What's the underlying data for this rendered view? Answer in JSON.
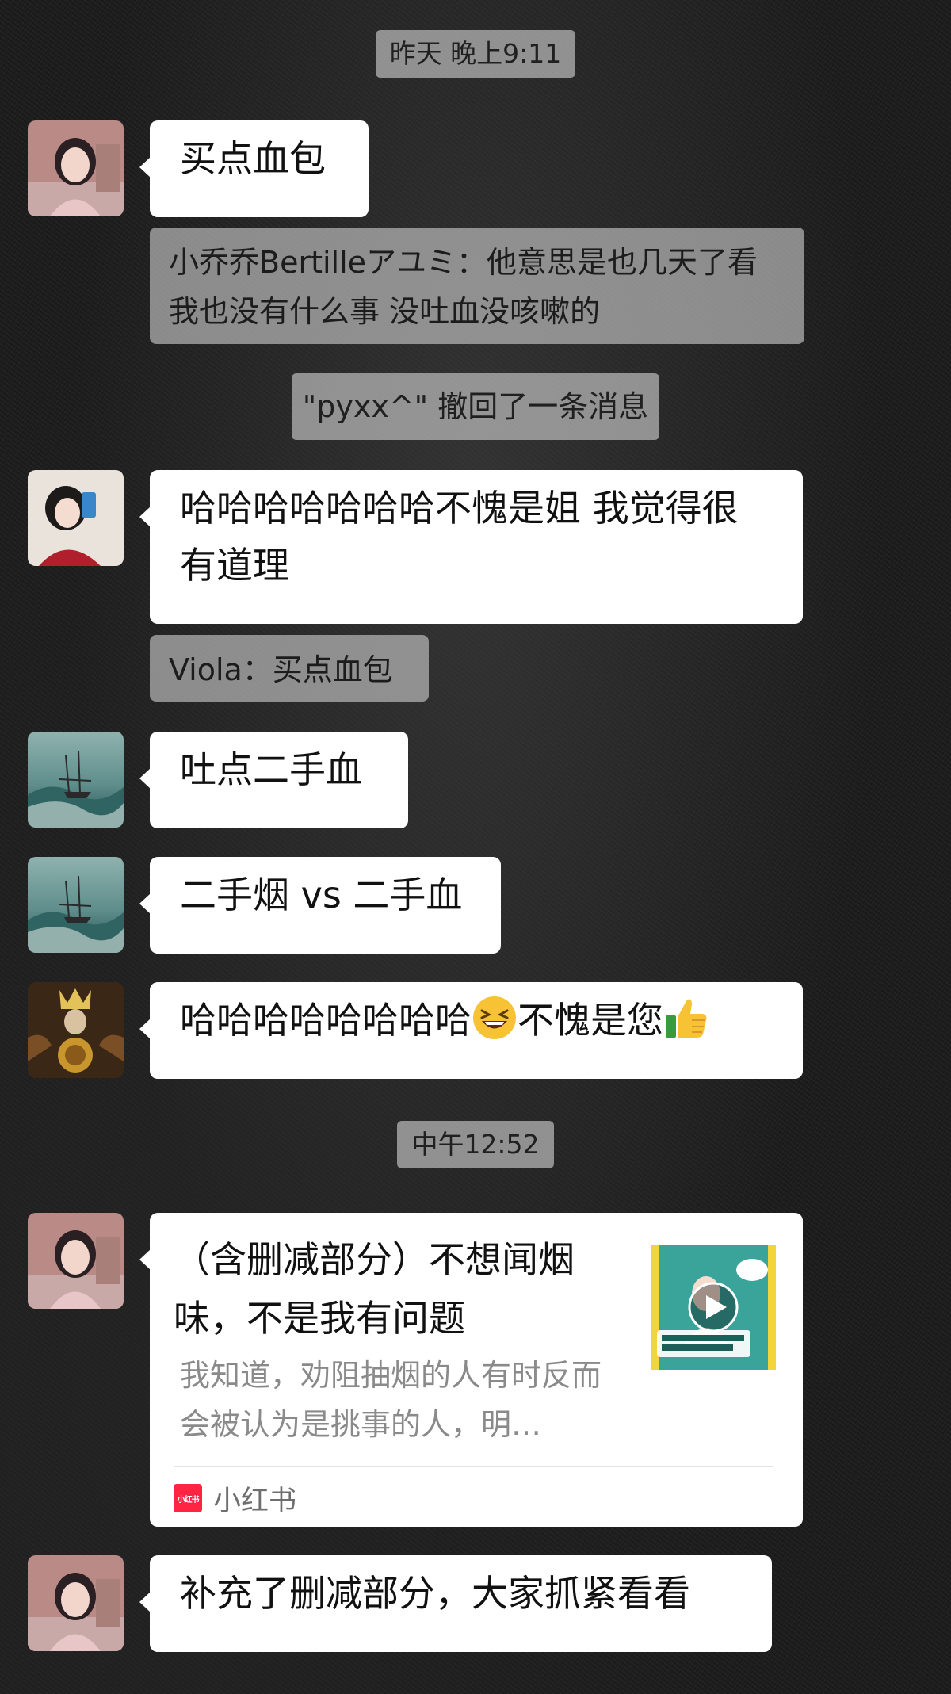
{
  "timestamps": {
    "t1": "昨天 晚上9:11",
    "t2": "中午12:52"
  },
  "system": {
    "recall_notice": "\"pyxx^\" 撤回了一条消息"
  },
  "messages": [
    {
      "sender_avatar": "avatar-woman-pink",
      "text": "买点血包"
    },
    {
      "quote": "小乔乔Bertilleアユミ：他意思是也几天了看我也没有什么事 没吐血没咳嗽的"
    },
    {
      "sender_avatar": "avatar-girl-mirror",
      "text": "哈哈哈哈哈哈哈不愧是姐 我觉得很有道理"
    },
    {
      "quote": "Viola：买点血包"
    },
    {
      "sender_avatar": "avatar-ship-painting",
      "text": "吐点二手血"
    },
    {
      "sender_avatar": "avatar-ship-painting",
      "text": "二手烟 vs 二手血"
    },
    {
      "sender_avatar": "avatar-tarot-card",
      "text_before": "哈哈哈哈哈哈哈哈",
      "text_after": "不愧是您",
      "emoji1": "grinning-squint-emoji",
      "emoji2": "thumbs-up-emoji"
    },
    {
      "sender_avatar": "avatar-woman-pink",
      "card": {
        "title": "（含删减部分）不想闻烟味，不是我有问题",
        "desc": "我知道，劝阻抽烟的人有时反而会被认为是挑事的人，明…",
        "source_logo": "小红书",
        "source_name": "小红书",
        "thumb_icon": "play-icon"
      }
    },
    {
      "sender_avatar": "avatar-woman-pink",
      "text": "补充了删减部分，大家抓紧看看"
    }
  ],
  "colors": {
    "bubble": "#ffffff",
    "system_pill": "#d2d2d2",
    "brand_xhs": "#ff2442"
  }
}
